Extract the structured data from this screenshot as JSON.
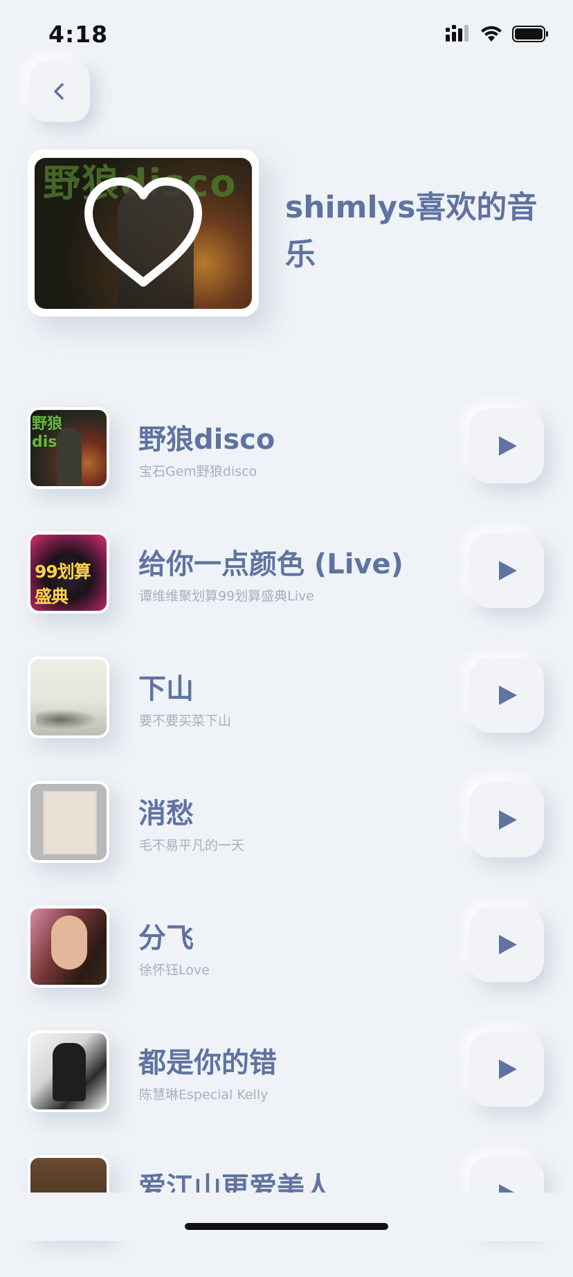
{
  "status_bar": {
    "time": "4:18"
  },
  "header": {
    "playlist_title": "shimlys喜欢的音乐"
  },
  "songs": [
    {
      "title": "野狼disco",
      "artist": "宝石Gem野狼disco"
    },
    {
      "title": "给你一点颜色 (Live)",
      "artist": "谭维维聚划算99划算盛典Live"
    },
    {
      "title": "下山",
      "artist": "要不要买菜下山"
    },
    {
      "title": "消愁",
      "artist": "毛不易平凡的一天"
    },
    {
      "title": "分飞",
      "artist": "徐怀钰Love"
    },
    {
      "title": "都是你的错",
      "artist": "陈慧琳Especial Kelly"
    },
    {
      "title": "爱江山更爱美人",
      "artist": ""
    }
  ],
  "artwork_text": {
    "cover": "野狼disco",
    "song_1": "野狼disco",
    "song_2": "99划算盛典"
  },
  "colors": {
    "background": "#eff2f6",
    "accent": "#5e73a0",
    "secondary_text": "#a6b0c2"
  },
  "icons": {
    "back": "chevron-left-icon",
    "play": "play-icon",
    "heart": "heart-outline-icon"
  }
}
